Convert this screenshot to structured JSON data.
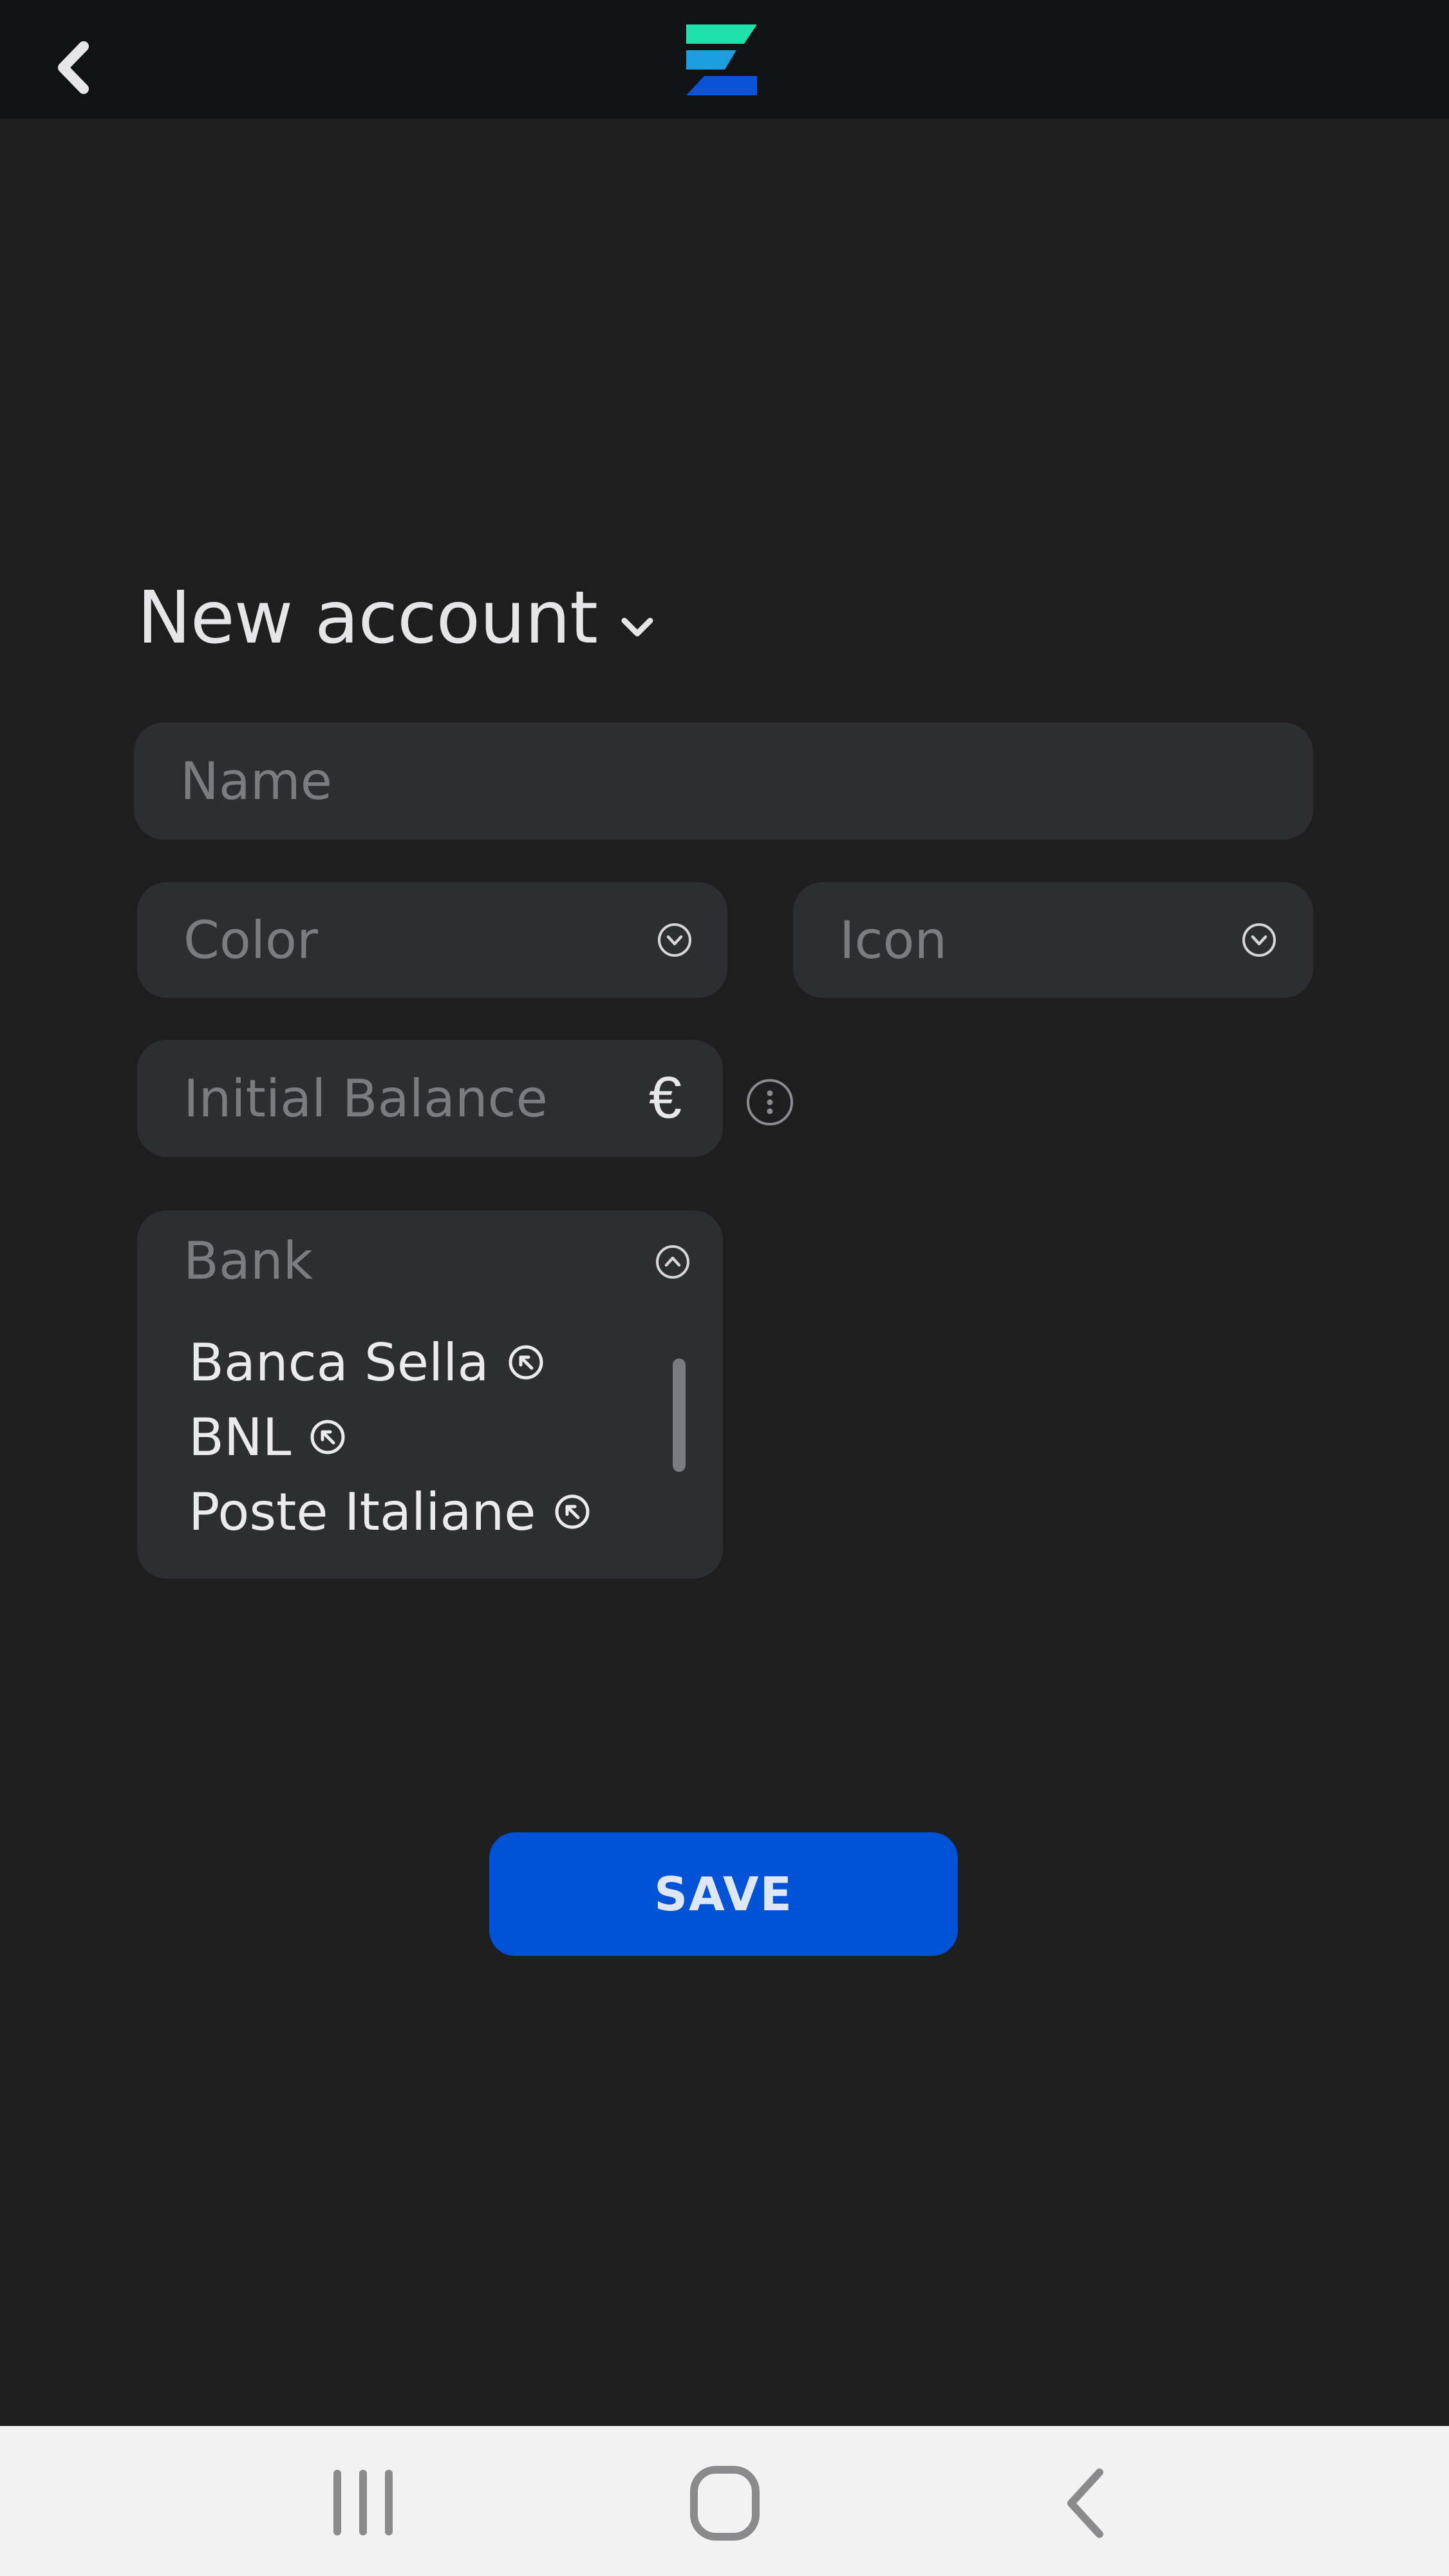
{
  "header": {
    "back_icon": "chevron-left-icon",
    "logo_icon": "app-logo",
    "logo_colors": [
      "#1fe0a8",
      "#1b9ee0",
      "#0a52d6"
    ]
  },
  "title": {
    "text": "New account",
    "dropdown_icon": "chevron-down-icon"
  },
  "form": {
    "name_placeholder": "Name",
    "color_placeholder": "Color",
    "icon_placeholder": "Icon",
    "initial_balance_placeholder": "Initial Balance",
    "currency_symbol": "€",
    "bank_label": "Bank",
    "bank_options": [
      "Banca Sella",
      "BNL",
      "Poste Italiane"
    ]
  },
  "actions": {
    "save_label": "SAVE"
  },
  "colors": {
    "background": "#1e1e1f",
    "topbar": "#111214",
    "field": "#2d2e32",
    "accent": "#0052d6"
  },
  "system_nav": {
    "recents_icon": "recents-icon",
    "home_icon": "home-icon",
    "back_icon": "back-icon"
  }
}
